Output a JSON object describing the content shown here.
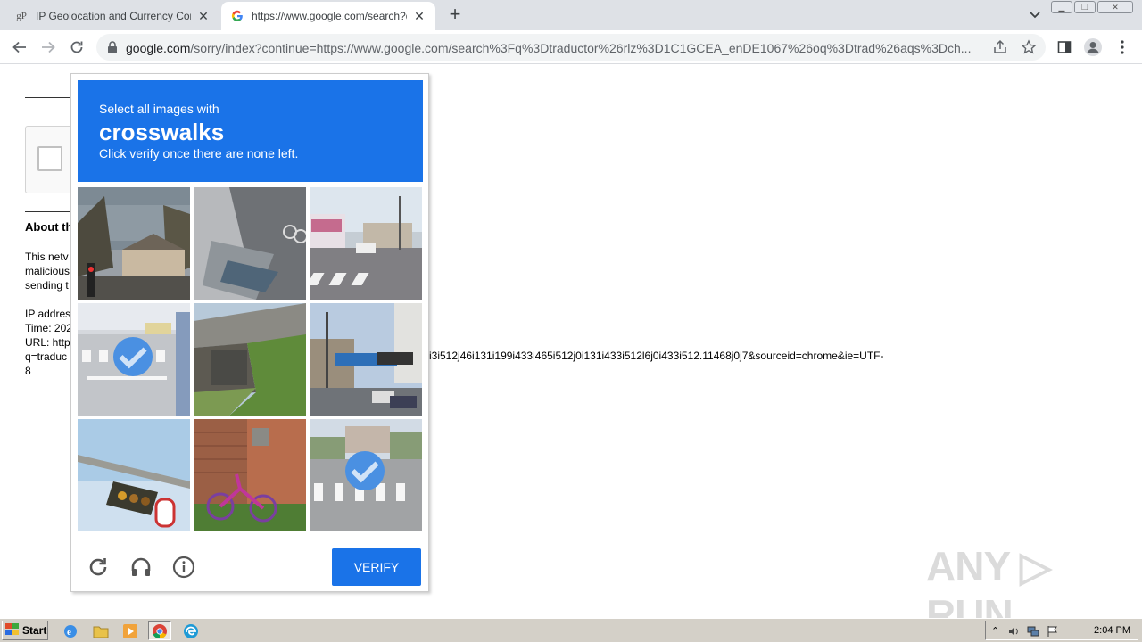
{
  "browser": {
    "tabs": [
      {
        "favicon_text": "gP",
        "title": "IP Geolocation and Currency Conver",
        "active": false
      },
      {
        "favicon_text": "G",
        "title": "https://www.google.com/search?q=",
        "active": true
      }
    ],
    "address": {
      "domain": "google.com",
      "path": "/sorry/index?continue=https://www.google.com/search%3Fq%3Dtraductor%26rlz%3D1C1GCEA_enDE1067%26oq%3Dtrad%26aqs%3Dch..."
    }
  },
  "page": {
    "about_heading": "About th",
    "paragraph1": "This netv\nmalicious\nsending t",
    "paragraph2": "IP addres\nTime: 202\nURL: http\nq=traduc\n8",
    "url_tail": "i3i512j46i131i199i433i465i512j0i131i433i512l6j0i433i512.11468j0j7&sourceid=chrome&ie=UTF-"
  },
  "captcha": {
    "instruction": "Select all images with",
    "target": "crosswalks",
    "hint": "Click verify once there are none left.",
    "tiles": [
      {
        "name": "tile-traffic-light-street",
        "selected": false
      },
      {
        "name": "tile-bike-lane-grate",
        "selected": false
      },
      {
        "name": "tile-bus-crosswalk",
        "selected": false
      },
      {
        "name": "tile-crosswalk-van",
        "selected": true
      },
      {
        "name": "tile-overpass",
        "selected": false
      },
      {
        "name": "tile-busy-intersection",
        "selected": false
      },
      {
        "name": "tile-traffic-signal-sign",
        "selected": false
      },
      {
        "name": "tile-bicycle-wall",
        "selected": false
      },
      {
        "name": "tile-road-crosswalk",
        "selected": true
      }
    ],
    "verify_label": "VERIFY"
  },
  "watermark": "ANY RUN",
  "taskbar": {
    "start_label": "Start",
    "clock": "2:04 PM"
  },
  "colors": {
    "captcha_blue": "#1a73e8",
    "check_blue": "#4a90e2"
  }
}
